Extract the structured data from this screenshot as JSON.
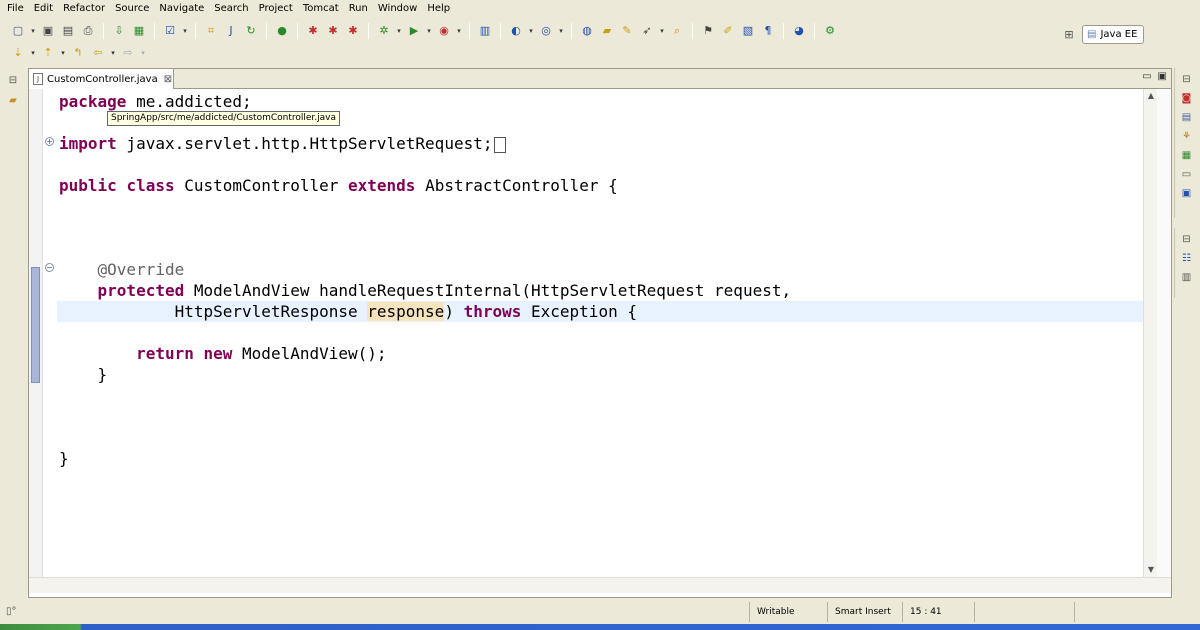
{
  "menu": [
    "File",
    "Edit",
    "Refactor",
    "Source",
    "Navigate",
    "Search",
    "Project",
    "Tomcat",
    "Run",
    "Window",
    "Help"
  ],
  "perspective": {
    "label": "Java EE"
  },
  "editor": {
    "tab_label": "CustomController.java",
    "tooltip": "SpringApp/src/me/addicted/CustomController.java",
    "code": {
      "l1_kw": "package",
      "l1_rest": " me.addicted;",
      "l3_kw": "import",
      "l3_rest": " javax.servlet.http.HttpServletRequest;",
      "l5_kw1": "public",
      "l5_kw2": "class",
      "l5_name": " CustomController ",
      "l5_kw3": "extends",
      "l5_rest": " AbstractController {",
      "l9_ann": "@Override",
      "l10_kw": "protected",
      "l10_rest": " ModelAndView handleRequestInternal(HttpServletRequest request,",
      "l11_pre": "HttpServletResponse ",
      "l11_hl": "response",
      "l11_mid": ") ",
      "l11_kw": "throws",
      "l11_rest": " Exception {",
      "l13_kw1": "return",
      "l13_kw2": "new",
      "l13_rest": " ModelAndView();",
      "l14": "}",
      "l18": "}"
    }
  },
  "status": {
    "writable": "Writable",
    "insert_mode": "Smart Insert",
    "position": "15 : 41"
  },
  "colors": {
    "keyword": "#7f0055",
    "annotation": "#646464",
    "current_line": "#e8f2fe",
    "occurrence_highlight": "#f6e4bf"
  }
}
